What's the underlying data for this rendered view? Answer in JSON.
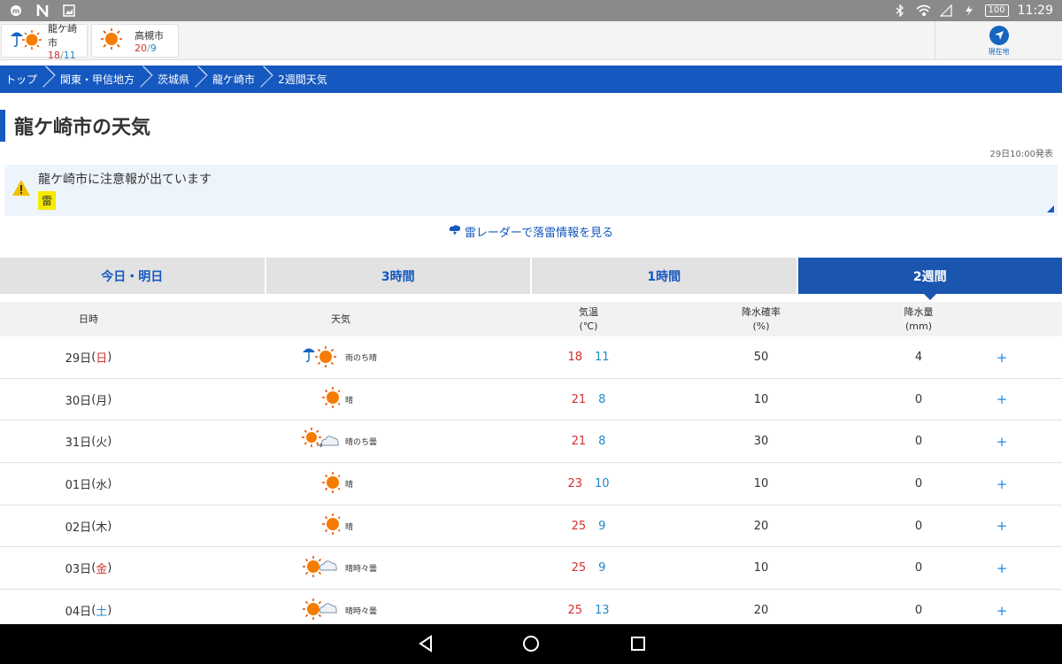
{
  "status_bar": {
    "time": "11:29",
    "battery": "100"
  },
  "locations": [
    {
      "name": "龍ケ崎市",
      "high": "18",
      "low": "11",
      "icon": "rain-then-sun-icon"
    },
    {
      "name": "高槻市",
      "high": "20",
      "low": "9",
      "icon": "sun-icon"
    }
  ],
  "current_location_label": "現在地",
  "breadcrumbs": [
    "トップ",
    "関東・甲信地方",
    "茨城県",
    "龍ケ崎市",
    "2週間天気"
  ],
  "page_title": "龍ケ崎市の天気",
  "issued": "29日10:00発表",
  "warning": {
    "text": "龍ケ崎市に注意報が出ています",
    "badge": "雷"
  },
  "radar_link": "雷レーダーで落雷情報を見る",
  "tabs": [
    "今日・明日",
    "3時間",
    "1時間",
    "2週間"
  ],
  "active_tab": "2週間",
  "table": {
    "headers": {
      "date": "日時",
      "weather": "天気",
      "temp": "気温",
      "temp_unit": "(℃)",
      "pop": "降水確率",
      "pop_unit": "(%)",
      "rain": "降水量",
      "rain_unit": "(mm)"
    },
    "rows": [
      {
        "day": "29日",
        "dow": "日",
        "dow_class": "sun",
        "weather": "雨のち晴",
        "icon": "rain-then-sun",
        "high": "18",
        "low": "11",
        "pop": "50",
        "rain": "4"
      },
      {
        "day": "30日",
        "dow": "月",
        "dow_class": "",
        "weather": "晴",
        "icon": "sun",
        "high": "21",
        "low": "8",
        "pop": "10",
        "rain": "0"
      },
      {
        "day": "31日",
        "dow": "火",
        "dow_class": "",
        "weather": "晴のち曇",
        "icon": "sun-then-cloud",
        "high": "21",
        "low": "8",
        "pop": "30",
        "rain": "0"
      },
      {
        "day": "01日",
        "dow": "水",
        "dow_class": "",
        "weather": "晴",
        "icon": "sun",
        "high": "23",
        "low": "10",
        "pop": "10",
        "rain": "0"
      },
      {
        "day": "02日",
        "dow": "木",
        "dow_class": "",
        "weather": "晴",
        "icon": "sun",
        "high": "25",
        "low": "9",
        "pop": "20",
        "rain": "0"
      },
      {
        "day": "03日",
        "dow": "金",
        "dow_class": "sun",
        "weather": "晴時々曇",
        "icon": "sun-sometimes-cloud",
        "high": "25",
        "low": "9",
        "pop": "10",
        "rain": "0"
      },
      {
        "day": "04日",
        "dow": "土",
        "dow_class": "sat",
        "weather": "晴時々曇",
        "icon": "sun-sometimes-cloud",
        "high": "25",
        "low": "13",
        "pop": "20",
        "rain": "0"
      }
    ],
    "expand_label": "+"
  },
  "colors": {
    "primary": "#1558c0",
    "high": "#d32f2f",
    "low": "#1e88c8",
    "warning_badge": "#f5e900"
  }
}
